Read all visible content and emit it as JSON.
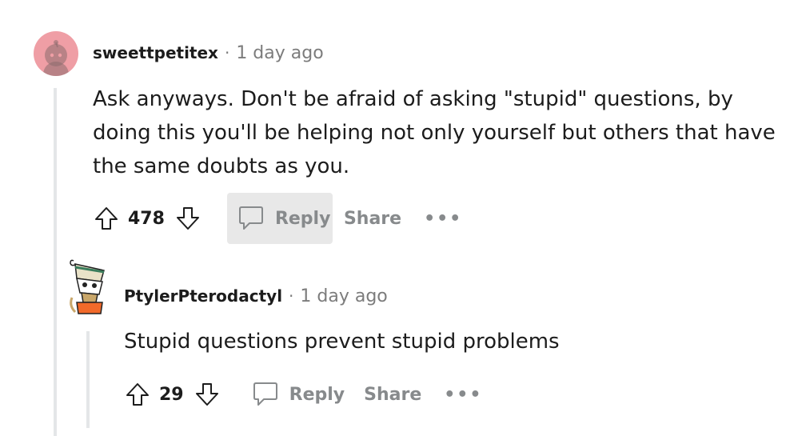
{
  "comments": [
    {
      "username": "sweettpetitex",
      "separator": "·",
      "timestamp": "1 day ago",
      "avatar_icon": "snoo-avatar-icon",
      "avatar_color": "#ef9ea5",
      "body_lines": [
        "Ask anyways. Don't be afraid of asking \"stupid\" questions, by",
        "doing this you'll be helping not only yourself but others that have",
        "the same doubts as you."
      ],
      "votes": "478",
      "reply_label": "Reply",
      "share_label": "Share",
      "more_label": "•••"
    },
    {
      "username": "PtylerPterodactyl",
      "separator": "·",
      "timestamp": "1 day ago",
      "avatar_icon": "custom-avatar-icon",
      "body_lines": [
        "Stupid questions prevent stupid problems"
      ],
      "votes": "29",
      "reply_label": "Reply",
      "share_label": "Share",
      "more_label": "•••"
    }
  ],
  "colors": {
    "text": "#1c1c1c",
    "meta": "#7c7c7c",
    "action": "#878a8c",
    "thread_line": "#e4e6e8",
    "hover_bg": "#e8e8e8"
  }
}
